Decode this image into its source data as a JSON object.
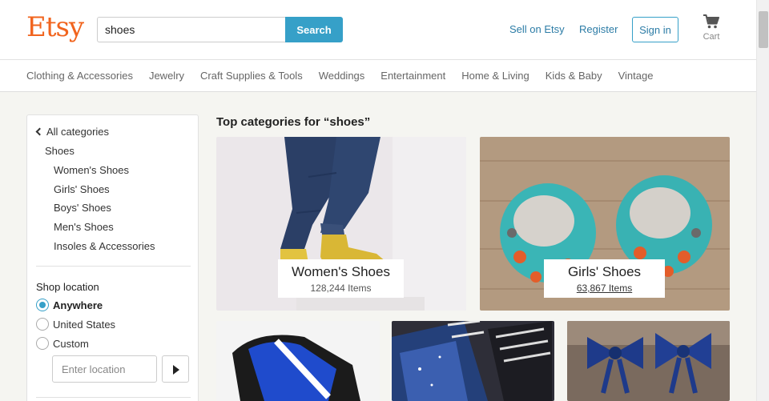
{
  "header": {
    "logo": "Etsy",
    "search_value": "shoes",
    "search_button": "Search",
    "sell_link": "Sell on Etsy",
    "register_link": "Register",
    "signin_button": "Sign in",
    "cart_label": "Cart",
    "brand_color": "#f1641e",
    "accent_color": "#36a0c8"
  },
  "category_nav": [
    "Clothing & Accessories",
    "Jewelry",
    "Craft Supplies & Tools",
    "Weddings",
    "Entertainment",
    "Home & Living",
    "Kids & Baby",
    "Vintage"
  ],
  "sidebar": {
    "back_link": "All categories",
    "current_category": "Shoes",
    "subcategories": [
      "Women's Shoes",
      "Girls' Shoes",
      "Boys' Shoes",
      "Men's Shoes",
      "Insoles & Accessories"
    ],
    "location_title": "Shop location",
    "location_options": [
      {
        "label": "Anywhere",
        "selected": true
      },
      {
        "label": "United States",
        "selected": false
      },
      {
        "label": "Custom",
        "selected": false
      }
    ],
    "location_placeholder": "Enter location"
  },
  "main": {
    "section_title": "Top categories for “shoes”",
    "categories": [
      {
        "name": "Women's Shoes",
        "count": "128,244 Items"
      },
      {
        "name": "Girls' Shoes",
        "count": "63,867 Items"
      }
    ]
  }
}
